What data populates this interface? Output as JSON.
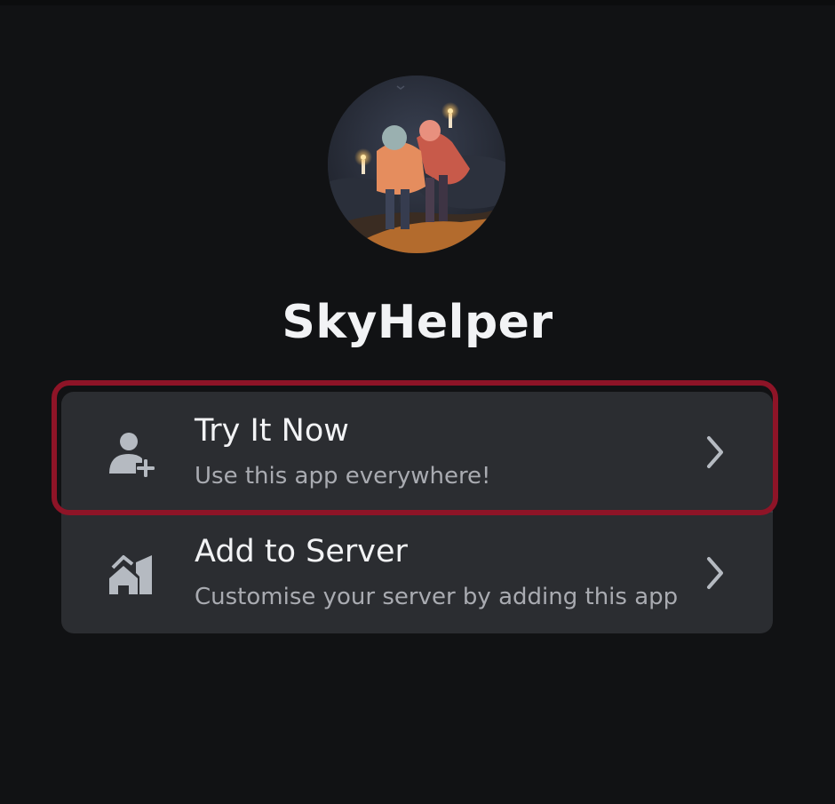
{
  "app": {
    "name": "SkyHelper",
    "avatar_icon": "skyhelper-avatar-illustration"
  },
  "actions": [
    {
      "title": "Try It Now",
      "subtitle": "Use this app everywhere!",
      "icon": "user-add-icon"
    },
    {
      "title": "Add to Server",
      "subtitle": "Customise your server by adding this app",
      "icon": "server-house-icon"
    }
  ],
  "colors": {
    "background": "#111214",
    "card": "#2b2d31",
    "title_text": "#f2f3f5",
    "subtitle_text": "#a9abb1",
    "icon": "#b5bac1",
    "highlight": "#8e1427"
  }
}
